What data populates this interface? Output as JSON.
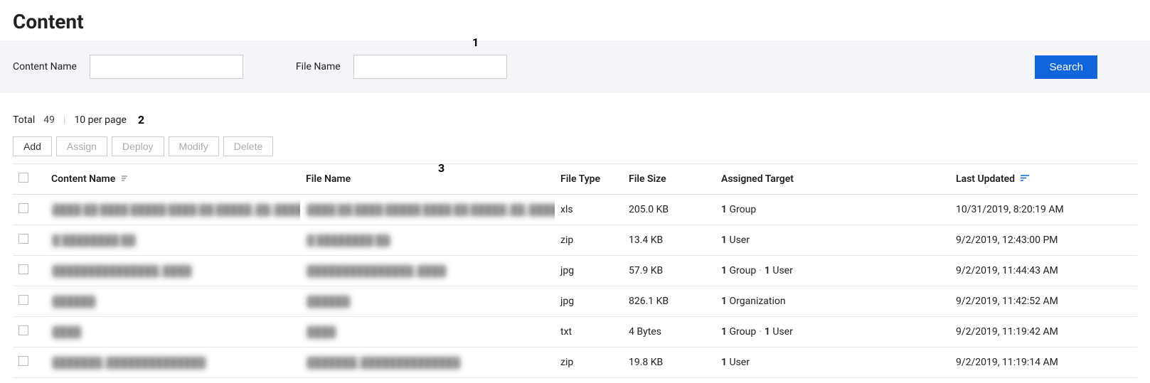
{
  "page_title": "Content",
  "annotations": {
    "a1": "1",
    "a2": "2",
    "a3": "3"
  },
  "filter": {
    "content_name_label": "Content Name",
    "file_name_label": "File Name",
    "search_label": "Search",
    "content_name_value": "",
    "file_name_value": ""
  },
  "meta": {
    "total_label": "Total",
    "total_value": "49",
    "per_page_label": "10 per page"
  },
  "actions": {
    "add": "Add",
    "assign": "Assign",
    "deploy": "Deploy",
    "modify": "Modify",
    "delete": "Delete"
  },
  "columns": {
    "content_name": "Content Name",
    "file_name": "File Name",
    "file_type": "File Type",
    "file_size": "File Size",
    "assigned_target": "Assigned Target",
    "last_updated": "Last Updated"
  },
  "rows": [
    {
      "content_name": "████ ██ ████ █████ ████-██-█████_██_███████",
      "file_name": "████ ██ ████ █████ ████-██-█████_██_███████",
      "file_type": "xls",
      "file_size": "205.0 KB",
      "assigned_target": [
        {
          "count": "1",
          "label": "Group"
        }
      ],
      "last_updated": "10/31/2019, 8:20:19 AM"
    },
    {
      "content_name": "█ ████████ ██",
      "file_name": "█ ████████ ██",
      "file_type": "zip",
      "file_size": "13.4 KB",
      "assigned_target": [
        {
          "count": "1",
          "label": "User"
        }
      ],
      "last_updated": "9/2/2019, 12:43:00 PM"
    },
    {
      "content_name": "███████████████_████",
      "file_name": "███████████████_████",
      "file_type": "jpg",
      "file_size": "57.9 KB",
      "assigned_target": [
        {
          "count": "1",
          "label": "Group"
        },
        {
          "count": "1",
          "label": "User"
        }
      ],
      "last_updated": "9/2/2019, 11:44:43 AM"
    },
    {
      "content_name": "██████",
      "file_name": "██████",
      "file_type": "jpg",
      "file_size": "826.1 KB",
      "assigned_target": [
        {
          "count": "1",
          "label": "Organization"
        }
      ],
      "last_updated": "9/2/2019, 11:42:52 AM"
    },
    {
      "content_name": "████",
      "file_name": "████",
      "file_type": "txt",
      "file_size": "4 Bytes",
      "assigned_target": [
        {
          "count": "1",
          "label": "Group"
        },
        {
          "count": "1",
          "label": "User"
        }
      ],
      "last_updated": "9/2/2019, 11:19:42 AM"
    },
    {
      "content_name": "███████_██████████████",
      "file_name": "███████_██████████████",
      "file_type": "zip",
      "file_size": "19.8 KB",
      "assigned_target": [
        {
          "count": "1",
          "label": "User"
        }
      ],
      "last_updated": "9/2/2019, 11:19:14 AM"
    }
  ]
}
